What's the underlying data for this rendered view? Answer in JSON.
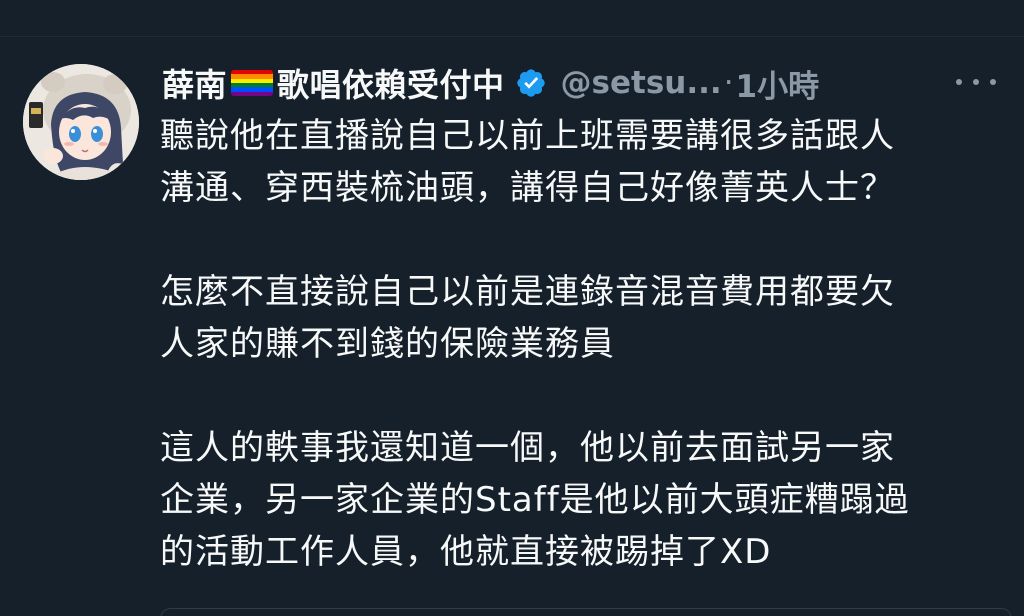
{
  "tweet": {
    "display_name_part1": "薛南",
    "display_name_part2": "歌唱依賴受付中",
    "handle": "@setsu...",
    "separator": "·",
    "time": "1小時",
    "flag_colors": [
      "#e40303",
      "#ff8c00",
      "#ffed00",
      "#008026",
      "#004dff",
      "#750787"
    ],
    "verified_color": "#1d9bf0",
    "body_lines": [
      "聽說他在直播說自己以前上班需要講很多話跟人",
      "溝通、穿西裝梳油頭，講得自己好像菁英人士？",
      "",
      "怎麼不直接說自己以前是連錄音混音費用都要欠",
      "人家的賺不到錢的保險業務員",
      "",
      "這人的軼事我還知道一個，他以前去面試另一家",
      "企業，另一家企業的Staff是他以前大頭症糟蹋過",
      "的活動工作人員，他就直接被踢掉了XD"
    ]
  },
  "icons": {
    "verified": "verified-badge-icon",
    "more": "more-options-icon",
    "flag": "rainbow-flag-icon"
  },
  "theme": {
    "background": "#15202b",
    "text": "#f7f9f9",
    "secondary_text": "#8b98a5"
  }
}
